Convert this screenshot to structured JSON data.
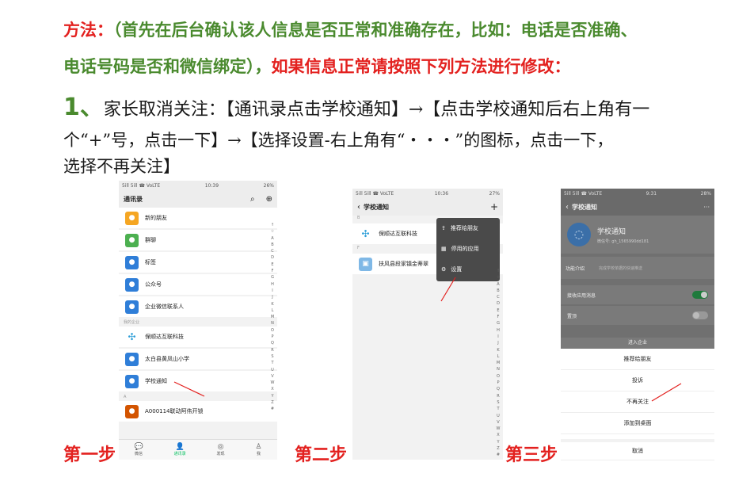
{
  "instructions": {
    "method_label": "方法：",
    "line1_rest": "（首先在后台确认该人信息是否正常和准确存在，比如：电话是否准确、",
    "line2_green": "电话号码是否和微信绑定），",
    "line2_red": "如果信息正常请按照下列方法进行修改：",
    "step_number": "1、",
    "line3_text": "家长取消关注：【通讯录点击学校通知】→【点击学校通知后右上角有一",
    "line4_text": "个“+”号，点击一下】→【选择设置-右上角有“・・・”的图标，点击一下，",
    "line5_text": "选择不再关注】"
  },
  "steps": {
    "step1": "第一步",
    "step2": "第二步",
    "step3": "第三步"
  },
  "phone1": {
    "status_left": "5ill 5ill ☎ VoLTE",
    "status_time": "10:39",
    "status_right": "26%",
    "title": "通讯录",
    "items": [
      {
        "label": "新的朋友",
        "icon": "person-add-icon",
        "color": "#f5a623"
      },
      {
        "label": "群聊",
        "icon": "group-icon",
        "color": "#4cb050"
      },
      {
        "label": "标签",
        "icon": "tag-icon",
        "color": "#2f7ed8"
      },
      {
        "label": "公众号",
        "icon": "official-account-icon",
        "color": "#2f7ed8"
      },
      {
        "label": "企业微信联系人",
        "icon": "wecom-icon",
        "color": "#2f7ed8"
      }
    ],
    "section": "我的企业",
    "items2": [
      {
        "label": "保顺达互联科技",
        "icon": "company-logo-icon",
        "color": "#ffffff"
      },
      {
        "label": "太白县黄凤山小学",
        "icon": "wecom-icon",
        "color": "#2f7ed8"
      },
      {
        "label": "学校通知",
        "icon": "wecom-icon",
        "color": "#2f7ed8"
      }
    ],
    "section2": "A",
    "items3": [
      {
        "label": "A000114联动阿伟开锁",
        "icon": "avatar-icon",
        "color": "#d35400"
      }
    ],
    "tabs": [
      {
        "label": "微信",
        "icon": "chat-icon"
      },
      {
        "label": "通讯录",
        "icon": "contacts-icon"
      },
      {
        "label": "发现",
        "icon": "discover-icon"
      },
      {
        "label": "我",
        "icon": "me-icon"
      }
    ],
    "index": [
      "↑",
      "☆",
      "A",
      "B",
      "C",
      "D",
      "E",
      "F",
      "G",
      "H",
      "I",
      "J",
      "K",
      "L",
      "M",
      "N",
      "O",
      "P",
      "Q",
      "R",
      "S",
      "T",
      "U",
      "V",
      "W",
      "X",
      "Y",
      "Z",
      "#"
    ]
  },
  "phone2": {
    "status_left": "5ill 5ill ☎ VoLTE",
    "status_time": "10:36",
    "status_right": "27%",
    "title": "学校通知",
    "section": "B",
    "item1": "保顺达互联科技",
    "section2": "F",
    "item2": "扶风县段家镇金蒂翠",
    "menu": [
      {
        "label": "推荐给朋友",
        "icon": "share-icon"
      },
      {
        "label": "停用的应用",
        "icon": "apps-icon"
      },
      {
        "label": "设置",
        "icon": "gear-icon"
      }
    ],
    "index": [
      "↑",
      "☆",
      "A",
      "B",
      "C",
      "D",
      "E",
      "F",
      "G",
      "H",
      "I",
      "J",
      "K",
      "L",
      "M",
      "N",
      "O",
      "P",
      "Q",
      "R",
      "S",
      "T",
      "U",
      "V",
      "W",
      "X",
      "Y",
      "Z",
      "#"
    ]
  },
  "phone3": {
    "status_left": "5ill 5ill ☎ VoLTE",
    "status_time": "9:31",
    "status_right": "28%",
    "title": "学校通知",
    "app_name": "学校通知",
    "app_id": "微信号: gh_1565990dd181",
    "func_label": "功能介绍",
    "func_value": "完成学校单据的快速推送",
    "toggle1": "接收应用消息",
    "toggle2": "置顶",
    "enter": "进入企业",
    "sheet": [
      "推荐给朋友",
      "投诉",
      "不再关注",
      "添加到桌面",
      "取消"
    ]
  }
}
